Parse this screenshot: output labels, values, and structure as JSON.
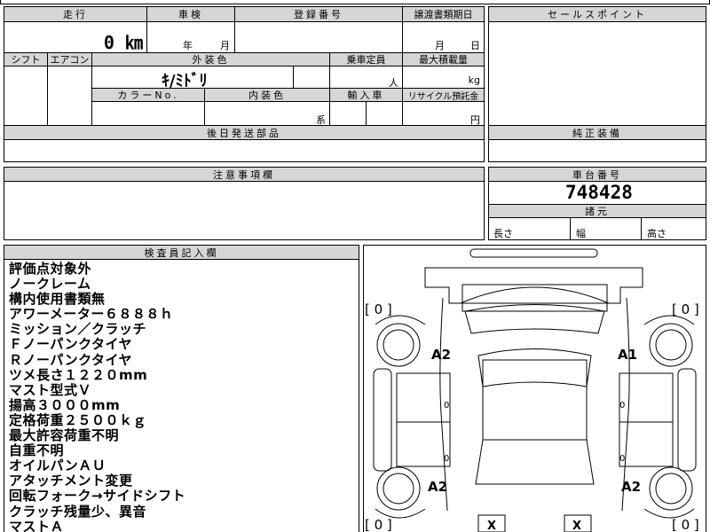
{
  "top_row": {
    "mileage_label": "走行",
    "mileage_value": "0 ㎞",
    "inspection_label": "車検",
    "inspection_year": "年",
    "inspection_month": "月",
    "registration_label": "登録番号",
    "transfer_label": "譲渡書類期日",
    "transfer_month": "月",
    "transfer_day": "日"
  },
  "second_row": {
    "shift_label": "シフト",
    "aircon_label": "エアコン",
    "exterior_color_label": "外装色",
    "exterior_color_value": "ｷ/ﾐﾄﾞﾘ",
    "capacity_label": "乗車定員",
    "capacity_unit": "人",
    "max_load_label": "最大積載量",
    "max_load_unit": "kg",
    "color_no_label": "カラーNo.",
    "interior_color_label": "内装色",
    "interior_color_unit": "系",
    "import_label": "輸入車",
    "recycle_label": "リサイクル預託金",
    "recycle_unit": "円",
    "later_parts_label": "後日発送部品"
  },
  "right_panels": {
    "sales_point_label": "セールスポイント",
    "genuine_equipment_label": "純正装備",
    "chassis_no_label": "車台番号",
    "chassis_no_value": "748428",
    "specs_label": "諸元",
    "length_label": "長さ",
    "width_label": "幅",
    "height_label": "高さ"
  },
  "notes": {
    "caution_label": "注意事項欄",
    "inspector_label": "検査員記入欄"
  },
  "remarks": [
    "評価点対象外",
    "ノークレーム",
    "構内使用書類無",
    "アワーメーター６８８８ｈ",
    "ミッション／クラッチ",
    "Ｆノーパンクタイヤ",
    "Ｒノーパンクタイヤ",
    "ツメ長さ１２２０mm",
    "マスト型式Ｖ",
    "揚高３０００mm",
    "定格荷重２５００ｋｇ",
    "最大許容荷重不明",
    "自重不明",
    "オイルパンＡＵ",
    "アタッチメント変更",
    "回転フォーク→サイドシフト",
    "クラッチ残量少、異音",
    "マストＡ"
  ],
  "diagram": {
    "bracket_left_top": "[ 0 ]",
    "bracket_right_top": "[ 0 ]",
    "bracket_left_bottom": "[ 0 ]",
    "bracket_right_bottom": "[ 0 ]",
    "tire_front_left": "A2",
    "tire_front_right": "A1",
    "tire_rear_left": "A2",
    "tire_rear_right": "A2",
    "door_marks": [
      "0",
      "0",
      "0",
      "0"
    ],
    "bottom_marks": [
      "X",
      "X"
    ]
  }
}
